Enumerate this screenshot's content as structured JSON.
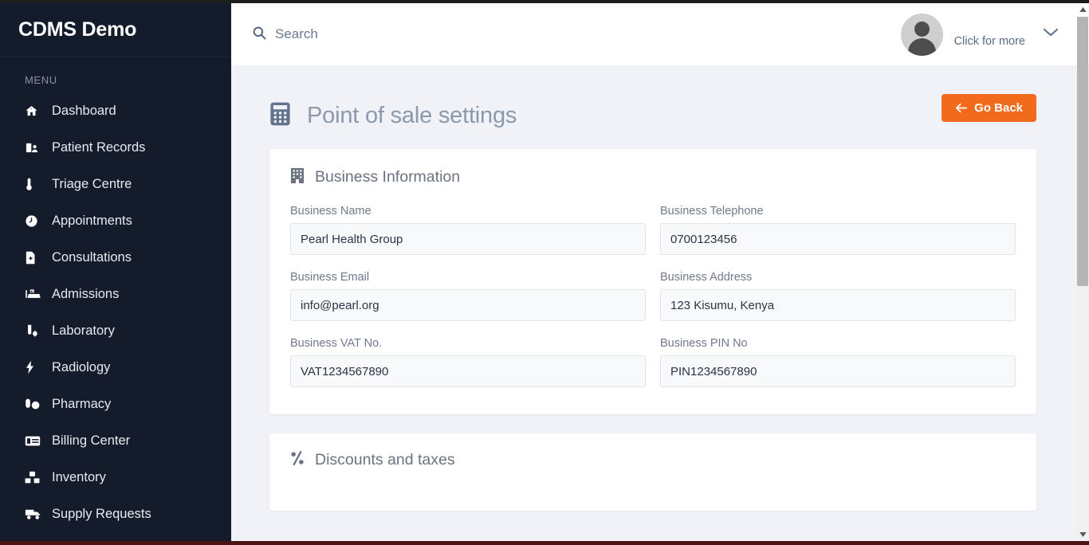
{
  "brand": {
    "title": "CDMS Demo"
  },
  "sidebar": {
    "section_label": "MENU",
    "items": [
      {
        "label": "Dashboard",
        "icon": "home-icon"
      },
      {
        "label": "Patient Records",
        "icon": "patient-records-icon"
      },
      {
        "label": "Triage Centre",
        "icon": "thermometer-icon"
      },
      {
        "label": "Appointments",
        "icon": "clock-icon"
      },
      {
        "label": "Consultations",
        "icon": "file-medical-icon"
      },
      {
        "label": "Admissions",
        "icon": "hospital-bed-icon"
      },
      {
        "label": "Laboratory",
        "icon": "test-tube-icon"
      },
      {
        "label": "Radiology",
        "icon": "bolt-icon"
      },
      {
        "label": "Pharmacy",
        "icon": "pills-icon"
      },
      {
        "label": "Billing Center",
        "icon": "invoice-icon"
      },
      {
        "label": "Inventory",
        "icon": "boxes-icon"
      },
      {
        "label": "Supply Requests",
        "icon": "truck-icon"
      }
    ]
  },
  "header": {
    "search_placeholder": "Search",
    "search_value": "",
    "account_label": "Click for more"
  },
  "page": {
    "title": "Point of sale settings",
    "title_icon": "calculator-icon",
    "go_back_label": "Go Back",
    "go_back_color": "#f26a1b"
  },
  "business_card": {
    "title": "Business Information",
    "icon": "building-icon",
    "rows": [
      [
        {
          "label": "Business Name",
          "value": "Pearl Health Group",
          "name": "business-name-input"
        },
        {
          "label": "Business Telephone",
          "value": "0700123456",
          "name": "business-telephone-input"
        }
      ],
      [
        {
          "label": "Business Email",
          "value": "info@pearl.org",
          "name": "business-email-input"
        },
        {
          "label": "Business Address",
          "value": "123 Kisumu, Kenya",
          "name": "business-address-input"
        }
      ],
      [
        {
          "label": "Business VAT No.",
          "value": "VAT1234567890",
          "name": "business-vat-input"
        },
        {
          "label": "Business PIN No",
          "value": "PIN1234567890",
          "name": "business-pin-input"
        }
      ]
    ]
  },
  "discounts_card": {
    "title": "Discounts and taxes",
    "icon": "percent-icon"
  },
  "colors": {
    "sidebar_bg": "#141b2b",
    "content_bg": "#f0f2f7",
    "accent": "#f26a1b",
    "muted_text": "#8c98ac"
  }
}
